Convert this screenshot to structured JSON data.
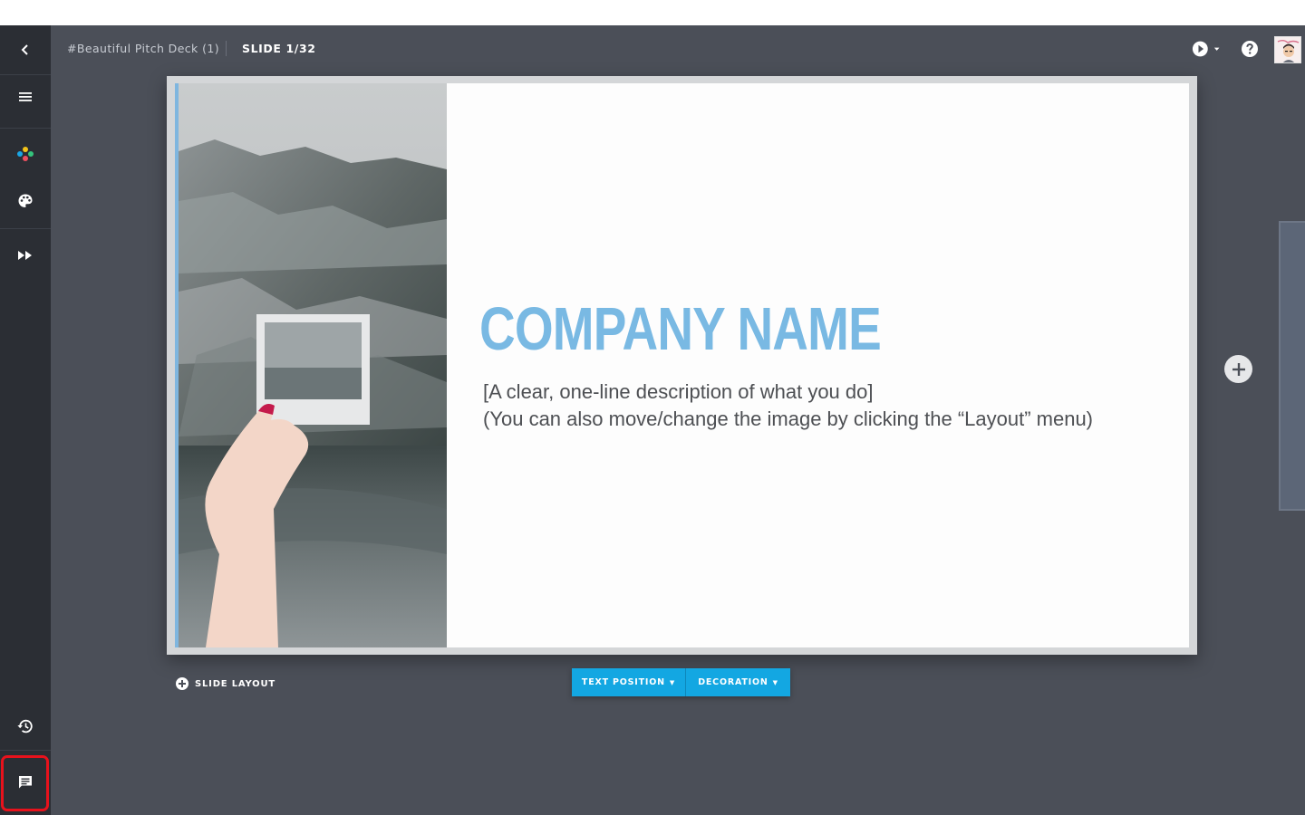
{
  "header": {
    "doc_title": "#Beautiful Pitch Deck (1)",
    "slide_counter": "SLIDE 1/32"
  },
  "rail": {
    "items": [
      {
        "name": "back",
        "icon": "chevron-left-icon"
      },
      {
        "name": "menu",
        "icon": "hamburger-icon"
      },
      {
        "name": "elements",
        "icon": "dots-cluster-icon"
      },
      {
        "name": "theme",
        "icon": "palette-icon"
      },
      {
        "name": "present",
        "icon": "fast-forward-icon"
      },
      {
        "name": "history",
        "icon": "history-icon"
      },
      {
        "name": "comments",
        "icon": "comment-icon"
      }
    ]
  },
  "slide": {
    "title": "COMPANY NAME",
    "line1": "[A clear, one-line description of what you do]",
    "line2": "(You can also move/change the image by clicking the “Layout” menu)"
  },
  "controls": {
    "slide_layout_label": "SLIDE LAYOUT",
    "text_position_label": "TEXT POSITION",
    "decoration_label": "DECORATION"
  },
  "colors": {
    "app_bg": "#4b4f58",
    "rail_bg": "#2b2e34",
    "title_blue": "#79b9e3",
    "toolbar_blue": "#13a7e2",
    "highlight_red": "#e8121c"
  }
}
